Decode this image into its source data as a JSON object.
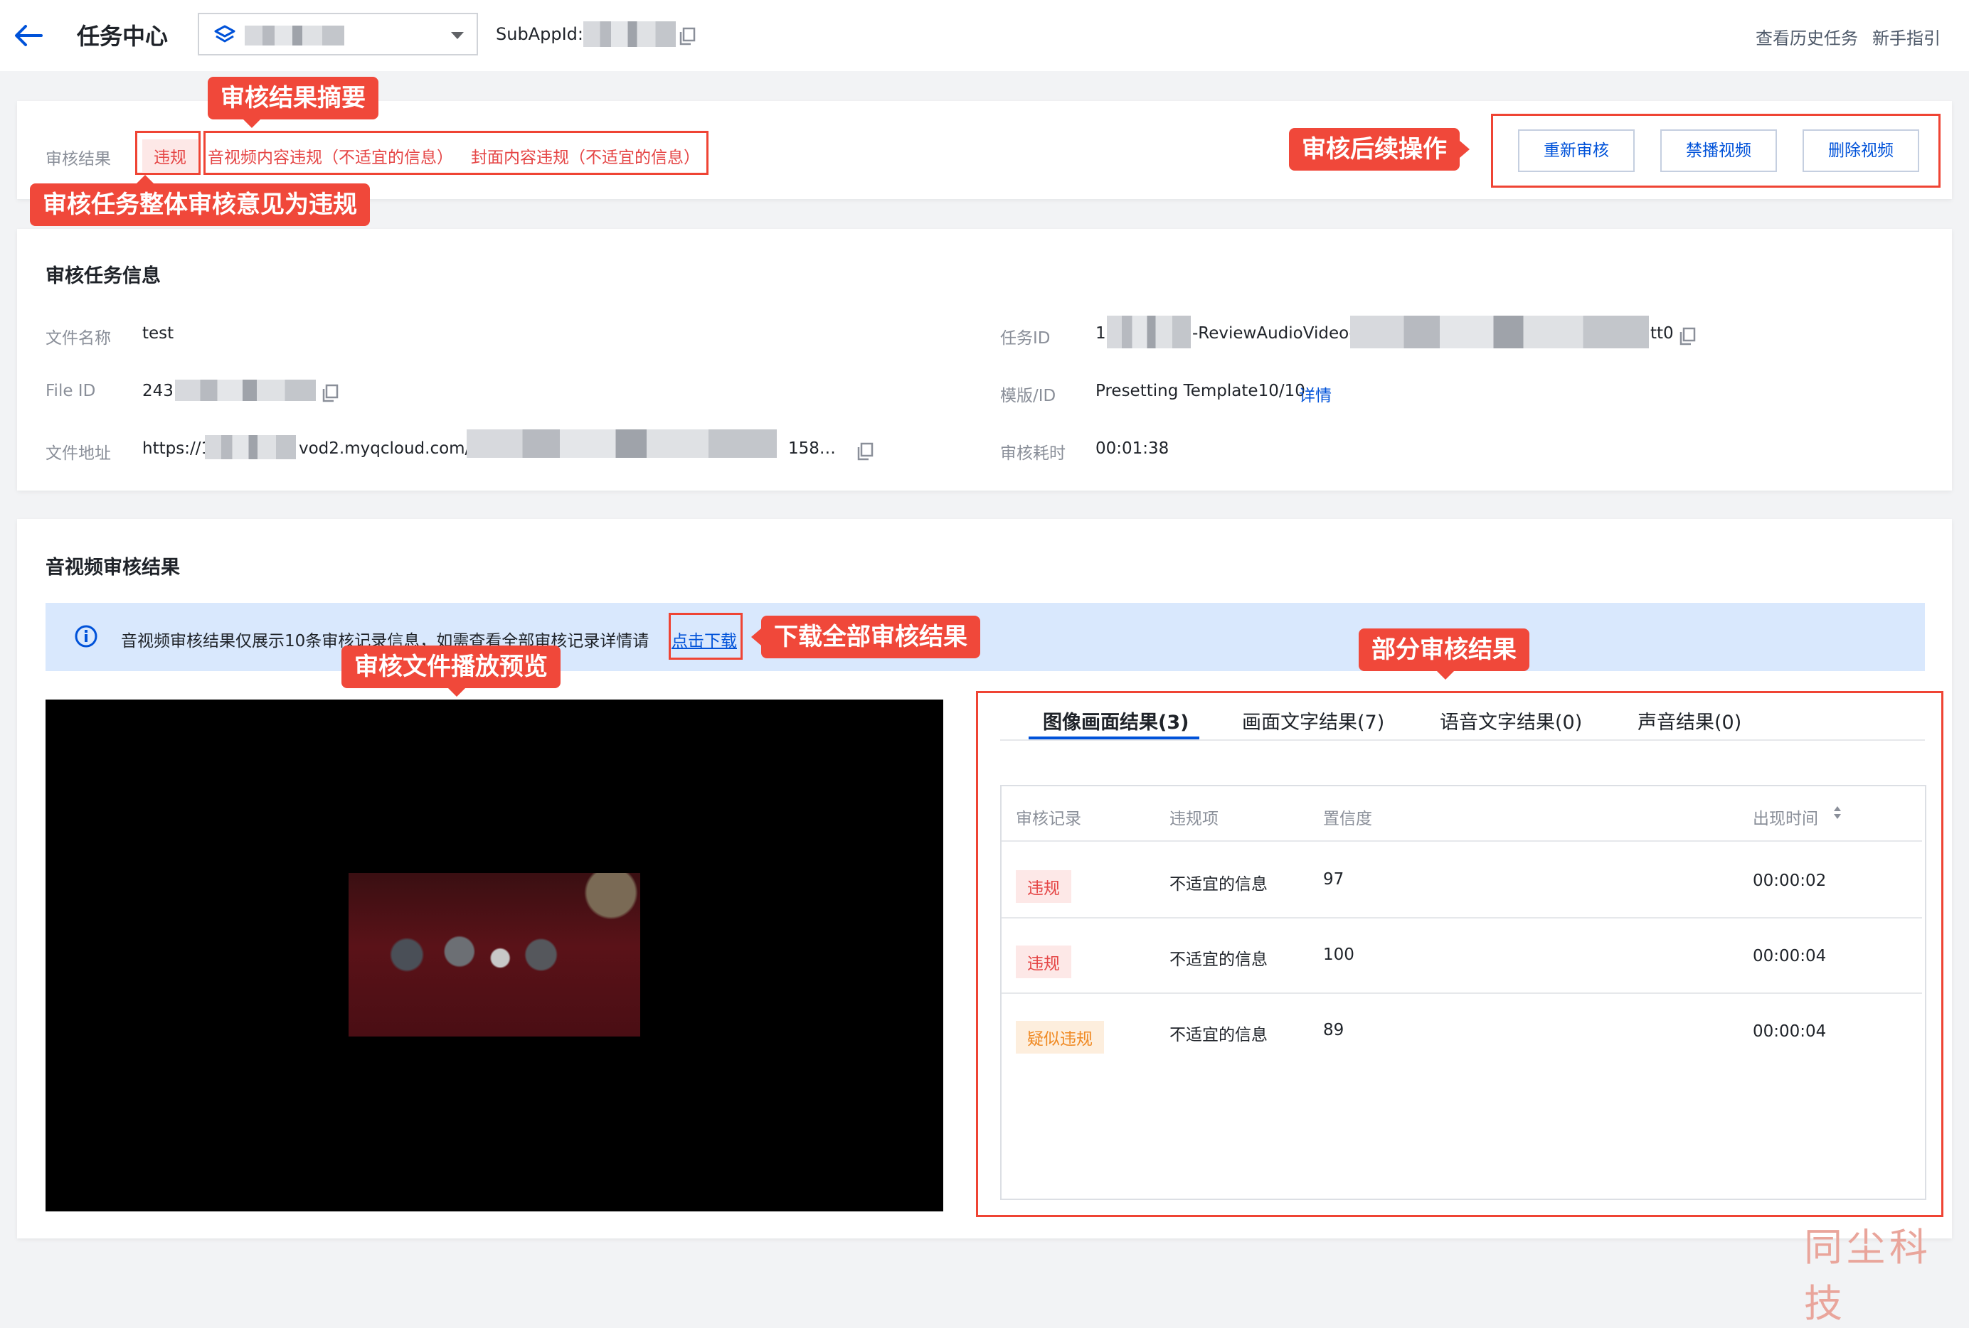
{
  "header": {
    "title": "任务中心",
    "subapp_label": "SubAppId:",
    "links": [
      "查看历史任务",
      "新手指引"
    ]
  },
  "summary": {
    "label": "审核结果",
    "status_tag": "违规",
    "items": [
      "音视频内容违规（不适宜的信息）",
      "封面内容违规（不适宜的信息）"
    ],
    "actions": [
      "重新审核",
      "禁播视频",
      "删除视频"
    ]
  },
  "callouts": {
    "summary": "审核结果摘要",
    "overall": "审核任务整体审核意见为违规",
    "actions": "审核后续操作",
    "download": "下载全部审核结果",
    "preview": "审核文件播放预览",
    "partial": "部分审核结果"
  },
  "task_info": {
    "title": "审核任务信息",
    "file_name_label": "文件名称",
    "file_name": "test",
    "file_id_label": "File ID",
    "file_id_prefix": "243",
    "file_url_label": "文件地址",
    "file_url_prefix": "https://1",
    "file_url_mid": "vod2.myqcloud.com/f",
    "file_url_suffix": "158…",
    "task_id_label": "任务ID",
    "task_id_prefix": "1",
    "task_id_mid": "-ReviewAudioVideo-",
    "task_id_suffix": "tt0",
    "template_label": "模版/ID",
    "template_value": "Presetting Template10/10",
    "template_link": "详情",
    "duration_label": "审核耗时",
    "duration": "00:01:38"
  },
  "av_results": {
    "title": "音视频审核结果",
    "notice_text": "音视频审核结果仅展示10条审核记录信息，如需查看全部审核记录详情请",
    "notice_link": "点击下载",
    "tabs": [
      "图像画面结果(3)",
      "画面文字结果(7)",
      "语音文字结果(0)",
      "声音结果(0)"
    ],
    "active_tab": 0,
    "columns": [
      "审核记录",
      "违规项",
      "置信度",
      "出现时间"
    ],
    "rows": [
      {
        "record": "违规",
        "item": "不适宜的信息",
        "confidence": "97",
        "time": "00:00:02"
      },
      {
        "record": "违规",
        "item": "不适宜的信息",
        "confidence": "100",
        "time": "00:00:04"
      },
      {
        "record": "疑似违规",
        "item": "不适宜的信息",
        "confidence": "89",
        "time": "00:00:04"
      }
    ]
  },
  "watermark": "同尘科技",
  "colors": {
    "accent": "#0052d9",
    "danger": "#e54545",
    "warning": "#f08a24",
    "annotation": "#ef4434"
  }
}
